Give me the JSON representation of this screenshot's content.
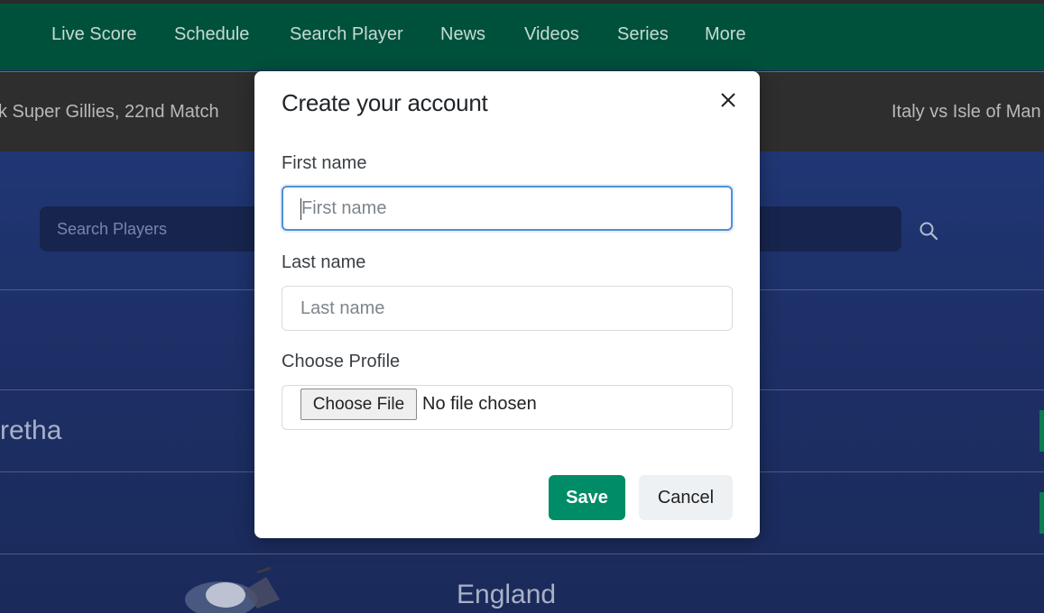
{
  "nav": {
    "items": [
      {
        "label": "Live Score"
      },
      {
        "label": "Schedule"
      },
      {
        "label": "Search Player"
      },
      {
        "label": "News"
      },
      {
        "label": "Videos"
      },
      {
        "label": "Series"
      },
      {
        "label": "More"
      }
    ]
  },
  "ticker": {
    "items": [
      {
        "label": "k Super Gillies, 22nd Match"
      },
      {
        "label": "Italy vs Isle of Man"
      }
    ]
  },
  "search": {
    "placeholder": "Search Players",
    "icon": "search-icon"
  },
  "list": {
    "rows": [
      {
        "name": "retha"
      },
      {
        "name": "England"
      }
    ]
  },
  "modal": {
    "title": "Create your account",
    "close_icon": "close-icon",
    "first_name": {
      "label": "First name",
      "placeholder": "First name",
      "value": ""
    },
    "last_name": {
      "label": "Last name",
      "placeholder": "Last name",
      "value": ""
    },
    "profile": {
      "label": "Choose Profile",
      "button_label": "Choose File",
      "status": "No file chosen"
    },
    "save_label": "Save",
    "cancel_label": "Cancel"
  },
  "colors": {
    "nav_bg": "#00513c",
    "ticker_bg": "#2e2e2e",
    "hero_bg": "#1b2a57",
    "save_bg": "#008c66",
    "focus_border": "#4f8fd6"
  }
}
